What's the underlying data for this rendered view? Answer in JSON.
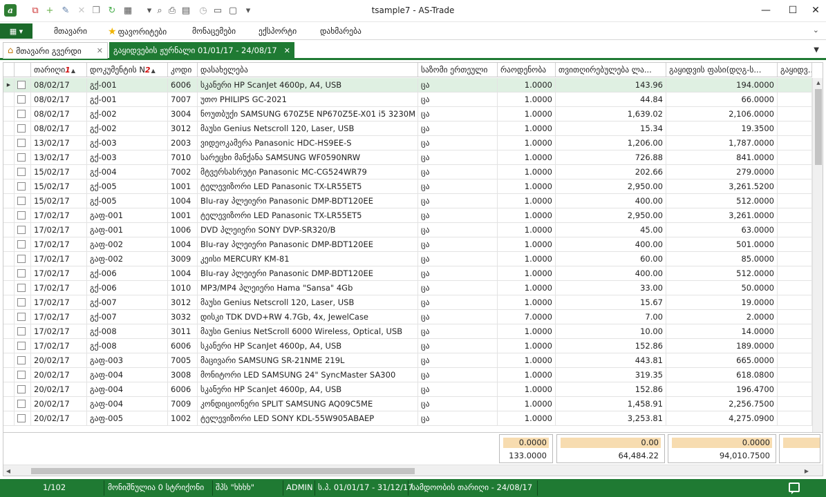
{
  "window": {
    "title": "tsample7 - AS-Trade",
    "minimize": "—",
    "maximize": "☐",
    "close": "✕"
  },
  "quick_access": [
    {
      "name": "view-icon",
      "glyph": "⧉",
      "color": "#c33"
    },
    {
      "name": "add-icon",
      "glyph": "+",
      "color": "#6ab04c"
    },
    {
      "name": "edit-icon",
      "glyph": "✎",
      "color": "#5d7ea8"
    },
    {
      "name": "delete-icon",
      "glyph": "✕",
      "color": "#c8c8c8"
    },
    {
      "name": "copy-icon",
      "glyph": "❐",
      "color": "#888"
    },
    {
      "name": "refresh-icon",
      "glyph": "↻",
      "color": "#4caf50"
    },
    {
      "name": "columns-icon",
      "glyph": "▦",
      "color": "#555"
    },
    {
      "name": "dropdown-icon",
      "glyph": "▾",
      "color": "#555"
    },
    {
      "name": "preview-icon",
      "glyph": "⌕",
      "color": "#555"
    },
    {
      "name": "print-icon",
      "glyph": "⎙",
      "color": "#555"
    },
    {
      "name": "export-icon",
      "glyph": "▤",
      "color": "#555"
    },
    {
      "name": "history-icon",
      "glyph": "◷",
      "color": "#aaa"
    },
    {
      "name": "layout-icon",
      "glyph": "▭",
      "color": "#555"
    },
    {
      "name": "window-icon",
      "glyph": "▢",
      "color": "#555"
    },
    {
      "name": "customize-icon",
      "glyph": "▾",
      "color": "#555"
    }
  ],
  "menu": {
    "toggle": "▦ ▾",
    "items": [
      "მთავარი",
      "ფავორიტები",
      "მონაცემები",
      "ექსპორტი",
      "დახმარება"
    ],
    "expand": "⌄"
  },
  "tabs": {
    "home": "მთავარი გვერდი",
    "active": "გაყიდვების ჟურნალი 01/01/17 - 24/08/17",
    "close": "✕",
    "dropdown": "▼"
  },
  "grid": {
    "headers": {
      "date": "თარიღი",
      "date_sort": "1",
      "doc": "დოკუმენტის N",
      "doc_sort": "2",
      "code": "კოდი",
      "name": "დასახელება",
      "unit": "საზომი ერთეული",
      "qty": "რაოდენობა",
      "cost": "თვითღირებულება ლა...",
      "price": "გაყიდვის ფასი(დღგ-ს...",
      "extra": "გაყიდვ..."
    },
    "sort_arrow": "▲",
    "row_indicator": "▶",
    "rows": [
      {
        "date": "08/02/17",
        "doc": "გქ-001",
        "code": "6006",
        "name": "სკანერი HP ScanJet 4600p, A4, USB",
        "unit": "ცა",
        "qty": "1.0000",
        "cost": "143.96",
        "price": "194.0000"
      },
      {
        "date": "08/02/17",
        "doc": "გქ-001",
        "code": "7007",
        "name": "უთო PHILIPS GC-2021",
        "unit": "ცა",
        "qty": "1.0000",
        "cost": "44.84",
        "price": "66.0000"
      },
      {
        "date": "08/02/17",
        "doc": "გქ-002",
        "code": "3004",
        "name": "ნოუთბუქი SAMSUNG 670Z5E NP670Z5E-X01 i5 3230M",
        "unit": "ცა",
        "qty": "1.0000",
        "cost": "1,639.02",
        "price": "2,106.0000"
      },
      {
        "date": "08/02/17",
        "doc": "გქ-002",
        "code": "3012",
        "name": "მაუსი Genius Netscroll 120, Laser, USB",
        "unit": "ცა",
        "qty": "1.0000",
        "cost": "15.34",
        "price": "19.3500"
      },
      {
        "date": "13/02/17",
        "doc": "გქ-003",
        "code": "2003",
        "name": "ვიდეოკამერა Panasonic HDC-HS9EE-S",
        "unit": "ცა",
        "qty": "1.0000",
        "cost": "1,206.00",
        "price": "1,787.0000"
      },
      {
        "date": "13/02/17",
        "doc": "გქ-003",
        "code": "7010",
        "name": "სარეცხი მანქანა SAMSUNG WF0590NRW",
        "unit": "ცა",
        "qty": "1.0000",
        "cost": "726.88",
        "price": "841.0000"
      },
      {
        "date": "15/02/17",
        "doc": "გქ-004",
        "code": "7002",
        "name": "მტვერსასრუტი Panasonic MC-CG524WR79",
        "unit": "ცა",
        "qty": "1.0000",
        "cost": "202.66",
        "price": "279.0000"
      },
      {
        "date": "15/02/17",
        "doc": "გქ-005",
        "code": "1001",
        "name": "ტელევიზორი LED Panasonic TX-LR55ET5",
        "unit": "ცა",
        "qty": "1.0000",
        "cost": "2,950.00",
        "price": "3,261.5200"
      },
      {
        "date": "15/02/17",
        "doc": "გქ-005",
        "code": "1004",
        "name": "Blu-ray პლეიერი Panasonic DMP-BDT120EE",
        "unit": "ცა",
        "qty": "1.0000",
        "cost": "400.00",
        "price": "512.0000"
      },
      {
        "date": "17/02/17",
        "doc": "გაფ-001",
        "code": "1001",
        "name": "ტელევიზორი LED Panasonic TX-LR55ET5",
        "unit": "ცა",
        "qty": "1.0000",
        "cost": "2,950.00",
        "price": "3,261.0000"
      },
      {
        "date": "17/02/17",
        "doc": "გაფ-001",
        "code": "1006",
        "name": "DVD პლეიერი SONY DVP-SR320/B",
        "unit": "ცა",
        "qty": "1.0000",
        "cost": "45.00",
        "price": "63.0000"
      },
      {
        "date": "17/02/17",
        "doc": "გაფ-002",
        "code": "1004",
        "name": "Blu-ray პლეიერი Panasonic DMP-BDT120EE",
        "unit": "ცა",
        "qty": "1.0000",
        "cost": "400.00",
        "price": "501.0000"
      },
      {
        "date": "17/02/17",
        "doc": "გაფ-002",
        "code": "3009",
        "name": "კეისი MERCURY KM-81",
        "unit": "ცა",
        "qty": "1.0000",
        "cost": "60.00",
        "price": "85.0000"
      },
      {
        "date": "17/02/17",
        "doc": "გქ-006",
        "code": "1004",
        "name": "Blu-ray პლეიერი Panasonic DMP-BDT120EE",
        "unit": "ცა",
        "qty": "1.0000",
        "cost": "400.00",
        "price": "512.0000"
      },
      {
        "date": "17/02/17",
        "doc": "გქ-006",
        "code": "1010",
        "name": "MP3/MP4 პლეიერი Hama \"Sansa\" 4Gb",
        "unit": "ცა",
        "qty": "1.0000",
        "cost": "33.00",
        "price": "50.0000"
      },
      {
        "date": "17/02/17",
        "doc": "გქ-007",
        "code": "3012",
        "name": "მაუსი Genius Netscroll 120, Laser, USB",
        "unit": "ცა",
        "qty": "1.0000",
        "cost": "15.67",
        "price": "19.0000"
      },
      {
        "date": "17/02/17",
        "doc": "გქ-007",
        "code": "3032",
        "name": "დისკი TDK DVD+RW 4.7Gb, 4x, JewelCase",
        "unit": "ცა",
        "qty": "7.0000",
        "cost": "7.00",
        "price": "2.0000"
      },
      {
        "date": "17/02/17",
        "doc": "გქ-008",
        "code": "3011",
        "name": "მაუსი Genius NetScroll 6000 Wireless, Optical, USB",
        "unit": "ცა",
        "qty": "1.0000",
        "cost": "10.00",
        "price": "14.0000"
      },
      {
        "date": "17/02/17",
        "doc": "გქ-008",
        "code": "6006",
        "name": "სკანერი HP ScanJet 4600p, A4, USB",
        "unit": "ცა",
        "qty": "1.0000",
        "cost": "152.86",
        "price": "189.0000"
      },
      {
        "date": "20/02/17",
        "doc": "გაფ-003",
        "code": "7005",
        "name": "მაცივარი SAMSUNG SR-21NME 219L",
        "unit": "ცა",
        "qty": "1.0000",
        "cost": "443.81",
        "price": "665.0000"
      },
      {
        "date": "20/02/17",
        "doc": "გაფ-004",
        "code": "3008",
        "name": "მონიტორი LED SAMSUNG 24\" SyncMaster SA300",
        "unit": "ცა",
        "qty": "1.0000",
        "cost": "319.35",
        "price": "618.0800"
      },
      {
        "date": "20/02/17",
        "doc": "გაფ-004",
        "code": "6006",
        "name": "სკანერი HP ScanJet 4600p, A4, USB",
        "unit": "ცა",
        "qty": "1.0000",
        "cost": "152.86",
        "price": "196.4700"
      },
      {
        "date": "20/02/17",
        "doc": "გაფ-004",
        "code": "7009",
        "name": "კონდიციონერი SPLIT SAMSUNG AQ09C5ME",
        "unit": "ცა",
        "qty": "1.0000",
        "cost": "1,458.91",
        "price": "2,256.7500"
      },
      {
        "date": "20/02/17",
        "doc": "გაფ-005",
        "code": "1002",
        "name": "ტელევიზორი LED SONY KDL-55W905ABAEP",
        "unit": "ცა",
        "qty": "1.0000",
        "cost": "3,253.81",
        "price": "4,275.0900"
      }
    ],
    "totals": {
      "qty_top": "0.0000",
      "qty_bottom": "133.0000",
      "cost_top": "0.00",
      "cost_bottom": "64,484.22",
      "price_top": "0.0000",
      "price_bottom": "94,010.7500"
    },
    "scroll": {
      "up": "▲",
      "down": "▼",
      "left": "◀",
      "right": "▶"
    }
  },
  "status": {
    "record": "1/102",
    "selected": "მონიშნულია 0 სტრიქონი",
    "company": "შპს \"ხხხხ\"",
    "user": "ADMIN",
    "period": "ს.პ. 01/01/17 - 31/12/17",
    "working_date": "სამდოობის თარიღი - 24/08/17"
  }
}
